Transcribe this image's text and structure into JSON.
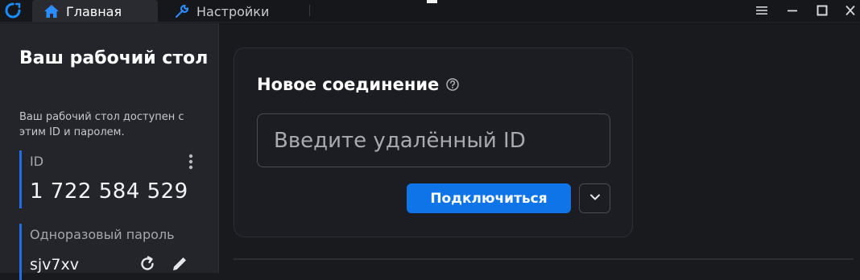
{
  "titlebar": {
    "tabs": [
      {
        "label": "Главная",
        "icon": "home-icon",
        "active": true
      },
      {
        "label": "Настройки",
        "icon": "wrench-icon",
        "active": false
      }
    ],
    "window_controls": [
      "menu-icon",
      "minimize-icon",
      "maximize-icon",
      "close-icon"
    ]
  },
  "sidebar": {
    "title": "Ваш рабочий стол",
    "description": "Ваш рабочий стол доступен с этим ID и паролем.",
    "id_label": "ID",
    "id_value": "1 722 584 529",
    "password_label": "Одноразовый пароль",
    "password_value": "sjv7xv"
  },
  "connection": {
    "title": "Новое соединение",
    "input_placeholder": "Введите удалённый ID",
    "input_value": "",
    "connect_label": "Подключиться"
  },
  "colors": {
    "accent": "#0f74e8",
    "sidebar_bg": "#23252b",
    "main_bg": "#191a1e"
  }
}
